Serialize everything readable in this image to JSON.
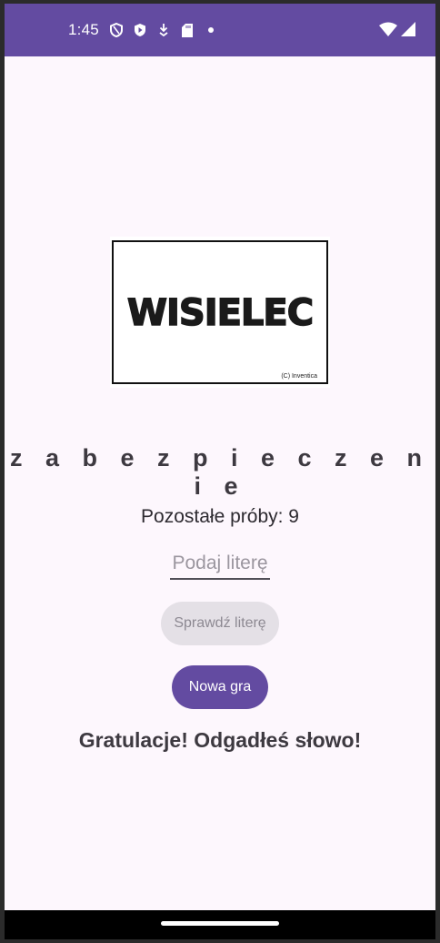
{
  "status_bar": {
    "time": "1:45",
    "icons": [
      "shield-outline-icon",
      "play-shield-icon",
      "download-icon",
      "sd-card-icon",
      "dot-icon",
      "wifi-icon",
      "cellular-icon"
    ],
    "color": "#634ba1"
  },
  "game": {
    "logo_text": "WISIELEC",
    "logo_credit": "(C) Inventica",
    "word": "z a b e z p i e c z e n i e",
    "attempts_label": "Pozostałe próby: 9",
    "letter_input_placeholder": "Podaj literę",
    "letter_input_value": "",
    "check_button_label": "Sprawdź literę",
    "new_game_button_label": "Nowa gra",
    "result_message": "Gratulacje! Odgadłeś słowo!"
  },
  "colors": {
    "accent": "#634ba1",
    "background": "#fdf7fd",
    "disabled_button": "#e4e0e6"
  }
}
